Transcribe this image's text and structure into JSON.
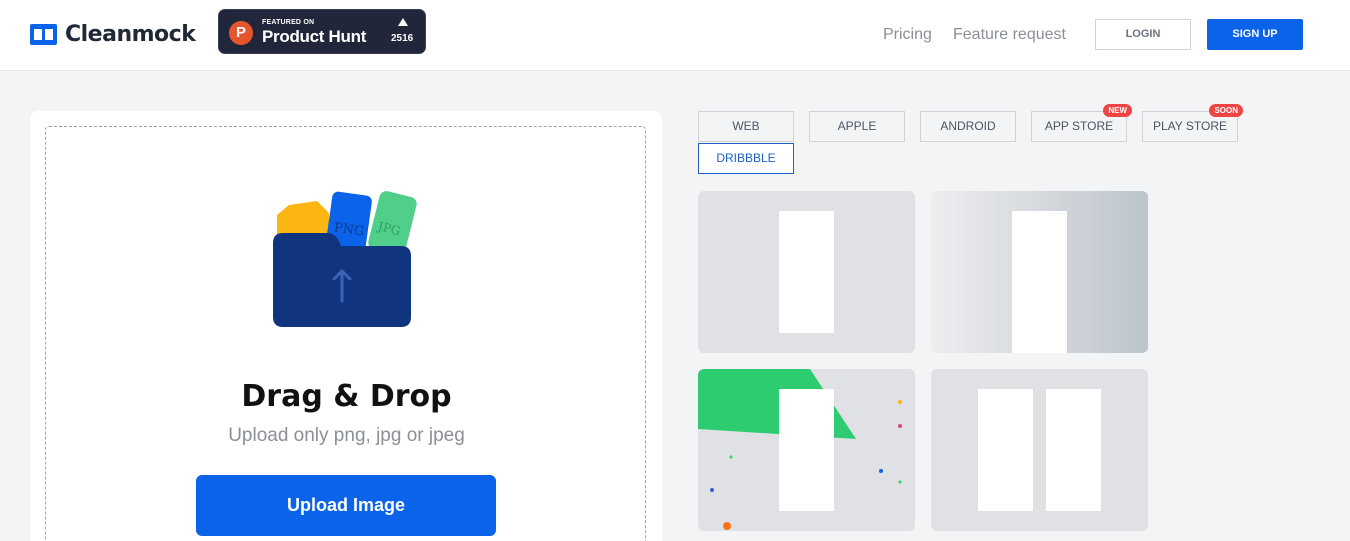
{
  "header": {
    "brand": "Cleanmock",
    "product_hunt": {
      "featured_on": "FEATURED ON",
      "name": "Product Hunt",
      "count": "2516",
      "logo_letter": "P"
    },
    "nav": {
      "pricing": "Pricing",
      "feature_request": "Feature request"
    },
    "login_label": "LOGIN",
    "signup_label": "SIGN UP"
  },
  "upload": {
    "title": "Drag & Drop",
    "subtitle": "Upload only png, jpg or jpeg",
    "button_label": "Upload Image",
    "file_labels": [
      "PNG",
      "JPG"
    ]
  },
  "tabs": [
    {
      "label": "WEB",
      "badge": ""
    },
    {
      "label": "APPLE",
      "badge": ""
    },
    {
      "label": "ANDROID",
      "badge": ""
    },
    {
      "label": "APP STORE",
      "badge": "NEW"
    },
    {
      "label": "PLAY STORE",
      "badge": "SOON"
    },
    {
      "label": "DRIBBBLE",
      "badge": ""
    }
  ],
  "active_tab": "DRIBBBLE",
  "colors": {
    "accent": "#0a63e9",
    "folder": "#11347f",
    "badge": "#ef4444",
    "green": "#2ecc71"
  }
}
